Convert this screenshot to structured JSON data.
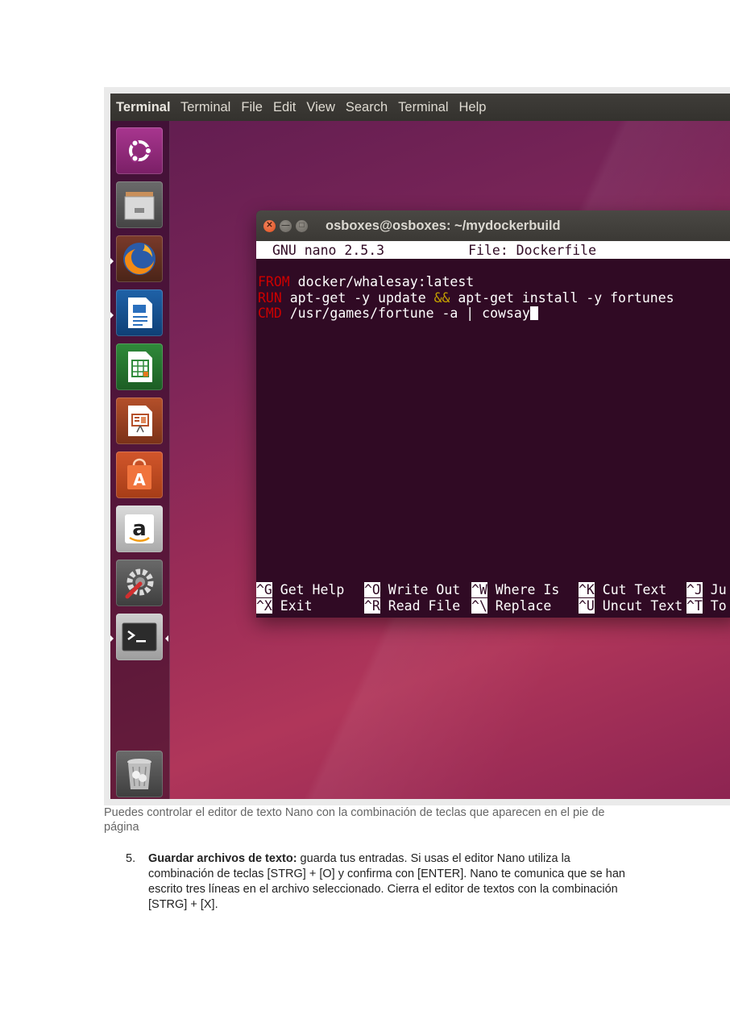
{
  "menubar": {
    "app_name": "Terminal",
    "items": [
      "Terminal",
      "File",
      "Edit",
      "View",
      "Search",
      "Terminal",
      "Help"
    ]
  },
  "launcher": {
    "items": [
      {
        "name": "ubuntu-dash-icon"
      },
      {
        "name": "files-icon"
      },
      {
        "name": "firefox-icon"
      },
      {
        "name": "libreoffice-writer-icon"
      },
      {
        "name": "libreoffice-calc-icon"
      },
      {
        "name": "libreoffice-impress-icon"
      },
      {
        "name": "ubuntu-software-icon"
      },
      {
        "name": "amazon-icon"
      },
      {
        "name": "system-settings-icon"
      },
      {
        "name": "terminal-icon"
      },
      {
        "name": "trash-icon"
      }
    ]
  },
  "terminal": {
    "title": "osboxes@osboxes: ~/mydockerbuild",
    "nano_version": "GNU nano 2.5.3",
    "file_label": "File: Dockerfile",
    "lines": [
      {
        "kw": "FROM",
        "rest": " docker/whalesay:latest"
      },
      {
        "kw": "RUN",
        "pre": " apt-get -y update ",
        "op": "&&",
        "post": " apt-get install -y fortunes"
      },
      {
        "kw": "CMD",
        "rest": " /usr/games/fortune -a | cowsay"
      }
    ],
    "shortcuts_row1": [
      {
        "key": "^G",
        "label": " Get Help"
      },
      {
        "key": "^O",
        "label": " Write Out"
      },
      {
        "key": "^W",
        "label": " Where Is"
      },
      {
        "key": "^K",
        "label": " Cut Text"
      },
      {
        "key": "^J",
        "label": " Ju"
      }
    ],
    "shortcuts_row2": [
      {
        "key": "^X",
        "label": " Exit"
      },
      {
        "key": "^R",
        "label": " Read File"
      },
      {
        "key": "^\\",
        "label": " Replace"
      },
      {
        "key": "^U",
        "label": " Uncut Text"
      },
      {
        "key": "^T",
        "label": " To"
      }
    ]
  },
  "caption": "Puedes controlar el editor de texto Nano con la combinación de teclas que aparecen en el pie de página",
  "step": {
    "number": "5.",
    "bold": "Guardar archivos de texto:",
    "text": " guarda tus entradas. Si usas el editor Nano utiliza la combinación de teclas [STRG] + [O] y confirma con [ENTER]. Nano te comunica que se han escrito tres líneas en el archivo seleccionado. Cierra el editor de textos con la combinación [STRG] + [X]."
  }
}
